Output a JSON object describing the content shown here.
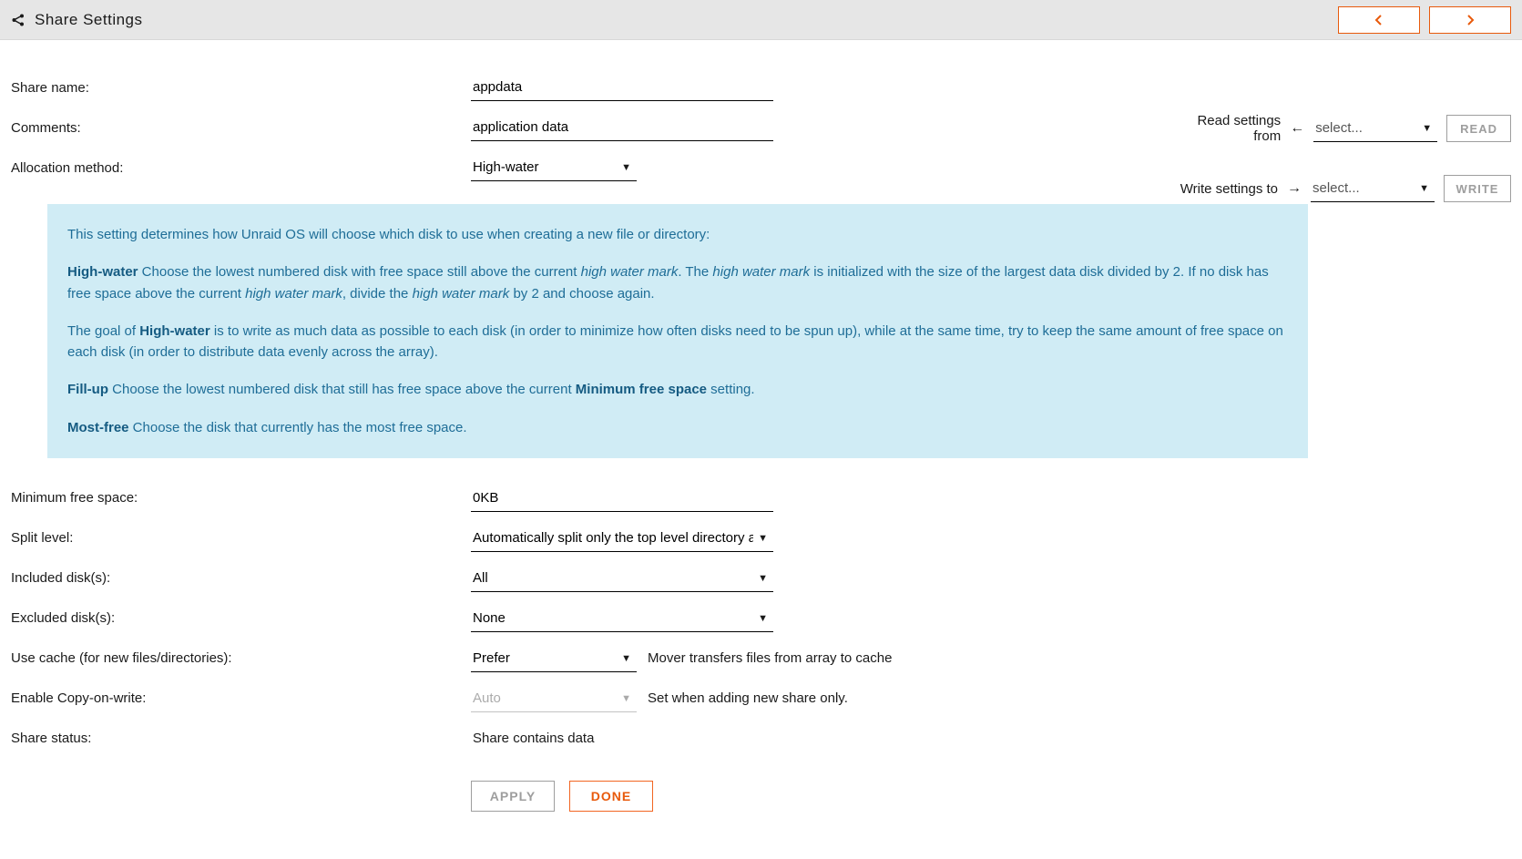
{
  "header": {
    "title": "Share Settings"
  },
  "sidebar": {
    "read_label": "Read settings from",
    "read_select": "select...",
    "read_button": "READ",
    "write_label": "Write settings to",
    "write_select": "select...",
    "write_button": "WRITE"
  },
  "fields": {
    "share_name": {
      "label": "Share name:",
      "value": "appdata"
    },
    "comments": {
      "label": "Comments:",
      "value": "application data"
    },
    "allocation_method": {
      "label": "Allocation method:",
      "value": "High-water"
    },
    "min_free_space": {
      "label": "Minimum free space:",
      "value": "0KB"
    },
    "split_level": {
      "label": "Split level:",
      "value": "Automatically split only the top level directory as ..."
    },
    "included_disks": {
      "label": "Included disk(s):",
      "value": "All"
    },
    "excluded_disks": {
      "label": "Excluded disk(s):",
      "value": "None"
    },
    "use_cache": {
      "label": "Use cache (for new files/directories):",
      "value": "Prefer",
      "note": "Mover transfers files from array to cache"
    },
    "copy_on_write": {
      "label": "Enable Copy-on-write:",
      "value": "Auto",
      "note": "Set when adding new share only."
    },
    "share_status": {
      "label": "Share status:",
      "value": "Share contains data"
    }
  },
  "help": {
    "intro": "This setting determines how Unraid OS will choose which disk to use when creating a new file or directory:",
    "hw_strong": "High-water",
    "hw_text1": " Choose the lowest numbered disk with free space still above the current ",
    "hw_em1": "high water mark",
    "hw_text2": ". The ",
    "hw_em2": "high water mark",
    "hw_text3": " is initialized with the size of the largest data disk divided by 2. If no disk has free space above the current ",
    "hw_em3": "high water mark",
    "hw_text4": ", divide the ",
    "hw_em4": "high water mark",
    "hw_text5": " by 2 and choose again.",
    "goal_text1": "The goal of ",
    "goal_strong": "High-water",
    "goal_text2": " is to write as much data as possible to each disk (in order to minimize how often disks need to be spun up), while at the same time, try to keep the same amount of free space on each disk (in order to distribute data evenly across the array).",
    "fu_strong": "Fill-up",
    "fu_text1": " Choose the lowest numbered disk that still has free space above the current ",
    "fu_strong2": "Minimum free space",
    "fu_text2": " setting.",
    "mf_strong": "Most-free",
    "mf_text": " Choose the disk that currently has the most free space."
  },
  "buttons": {
    "apply": "APPLY",
    "done": "DONE"
  }
}
